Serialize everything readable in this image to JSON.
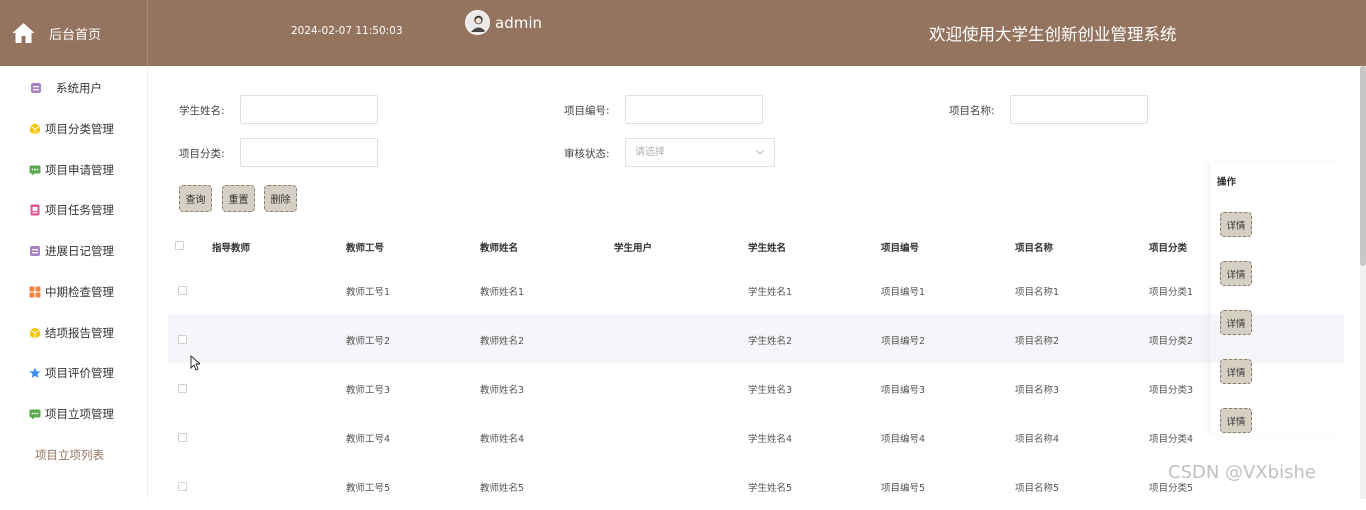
{
  "header": {
    "home_label": "后台首页",
    "datetime": "2024-02-07 11:50:03",
    "username": "admin",
    "site_title": "欢迎使用大学生创新创业管理系统",
    "bg_color": "#94735f"
  },
  "sidebar": {
    "items": [
      {
        "label": "系统用户",
        "icon": "archive-icon",
        "color": "#a97fc4"
      },
      {
        "label": "项目分类管理",
        "icon": "cube-icon",
        "color": "#f2c811"
      },
      {
        "label": "项目申请管理",
        "icon": "message-icon",
        "color": "#5aa84e"
      },
      {
        "label": "项目任务管理",
        "icon": "document-icon",
        "color": "#e05a9a"
      },
      {
        "label": "进展日记管理",
        "icon": "archive-icon",
        "color": "#a97fc4"
      },
      {
        "label": "中期检查管理",
        "icon": "grid-icon",
        "color": "#f0823c"
      },
      {
        "label": "结项报告管理",
        "icon": "cube-icon",
        "color": "#f2c811"
      },
      {
        "label": "项目评价管理",
        "icon": "star-icon",
        "color": "#3c8ef0"
      },
      {
        "label": "项目立项管理",
        "icon": "message-icon",
        "color": "#5aa84e"
      },
      {
        "label": "项目立项列表",
        "icon": "",
        "color": ""
      }
    ]
  },
  "search": {
    "student_name_label": "学生姓名:",
    "project_no_label": "项目编号:",
    "project_name_label": "项目名称:",
    "project_category_label": "项目分类:",
    "audit_status_label": "审核状态:",
    "audit_status_placeholder": "请选择",
    "query_button": "查询",
    "reset_button": "重置",
    "delete_button": "删除"
  },
  "table": {
    "headers": [
      "指导教师",
      "教师工号",
      "教师姓名",
      "学生用户",
      "学生姓名",
      "项目编号",
      "项目名称",
      "项目分类",
      "操作"
    ],
    "rows": [
      {
        "teacher": "",
        "teacher_no": "教师工号1",
        "teacher_name": "教师姓名1",
        "student_user": "",
        "student_name": "学生姓名1",
        "project_no": "项目编号1",
        "project_name": "项目名称1",
        "category": "项目分类1"
      },
      {
        "teacher": "",
        "teacher_no": "教师工号2",
        "teacher_name": "教师姓名2",
        "student_user": "",
        "student_name": "学生姓名2",
        "project_no": "项目编号2",
        "project_name": "项目名称2",
        "category": "项目分类2"
      },
      {
        "teacher": "",
        "teacher_no": "教师工号3",
        "teacher_name": "教师姓名3",
        "student_user": "",
        "student_name": "学生姓名3",
        "project_no": "项目编号3",
        "project_name": "项目名称3",
        "category": "项目分类3"
      },
      {
        "teacher": "",
        "teacher_no": "教师工号4",
        "teacher_name": "教师姓名4",
        "student_user": "",
        "student_name": "学生姓名4",
        "project_no": "项目编号4",
        "project_name": "项目名称4",
        "category": "项目分类4"
      },
      {
        "teacher": "",
        "teacher_no": "教师工号5",
        "teacher_name": "教师姓名5",
        "student_user": "",
        "student_name": "学生姓名5",
        "project_no": "项目编号5",
        "project_name": "项目名称5",
        "category": "项目分类5"
      }
    ],
    "detail_button": "详情"
  },
  "watermark": "CSDN @VXbishe"
}
